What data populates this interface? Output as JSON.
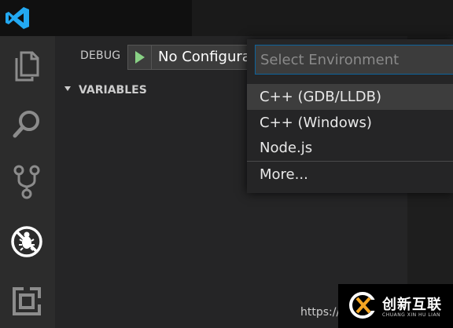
{
  "window": {
    "logo_icon": "vscode-logo-icon"
  },
  "activity_bar": {
    "items": [
      {
        "name": "explorer",
        "icon": "files-icon"
      },
      {
        "name": "search",
        "icon": "search-icon"
      },
      {
        "name": "source-control",
        "icon": "git-branch-icon"
      },
      {
        "name": "debug",
        "icon": "debug-no-bug-icon",
        "active": true
      },
      {
        "name": "extensions",
        "icon": "extensions-icon"
      }
    ]
  },
  "debug": {
    "label": "DEBUG",
    "run_icon": "play-icon",
    "configuration": "No Configura"
  },
  "variables": {
    "title": "VARIABLES"
  },
  "quick_pick": {
    "placeholder": "Select Environment",
    "items": [
      {
        "label": "C++ (GDB/LLDB)",
        "selected": true
      },
      {
        "label": "C++ (Windows)",
        "selected": false
      },
      {
        "label": "Node.js",
        "selected": false
      },
      {
        "label": "More...",
        "selected": false
      }
    ]
  },
  "overlay": {
    "url_text": "https://l",
    "watermark_title": "创新互联",
    "watermark_subtitle": "CHUANG XIN HU LIAN"
  },
  "colors": {
    "accent": "#0e639c",
    "play_green": "#89d185",
    "logo_blue": "#23a9f2"
  }
}
